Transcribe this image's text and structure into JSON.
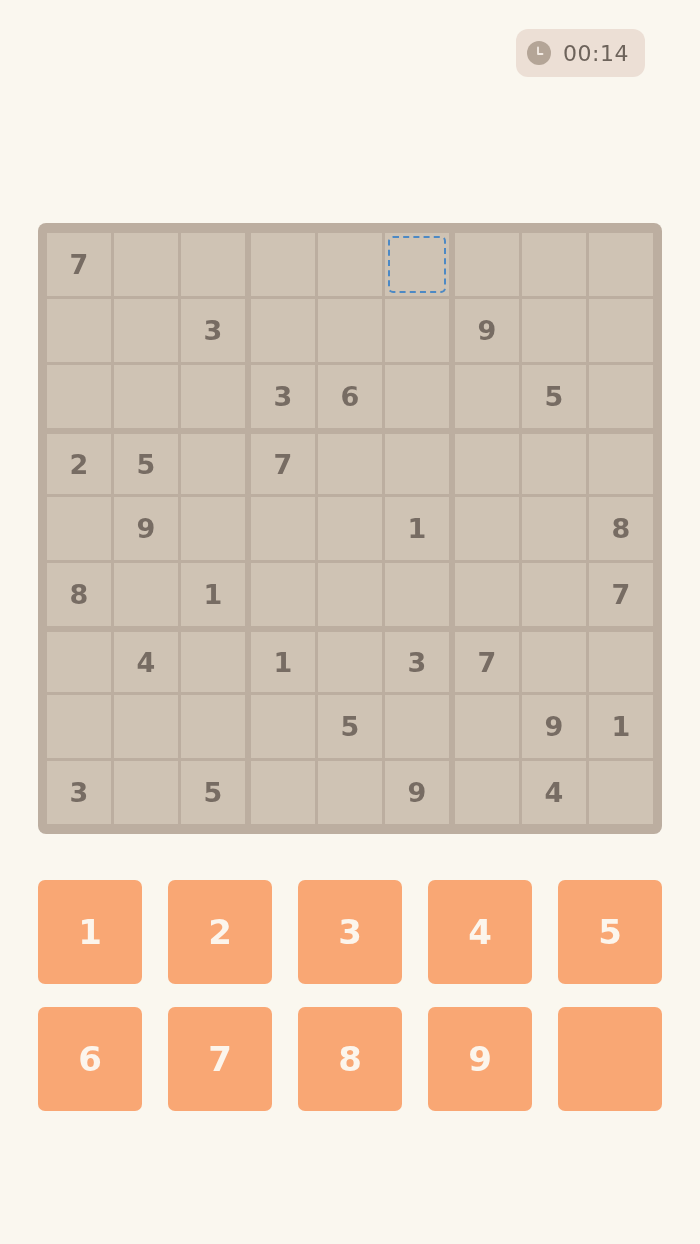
{
  "timer": {
    "text": "00:14"
  },
  "board": {
    "rows": [
      {
        "cells": [
          {
            "value": "7",
            "selected": false
          },
          {
            "selected": false
          },
          {
            "selected": false
          },
          {
            "selected": false
          },
          {
            "selected": false
          },
          {
            "selected": true
          },
          {
            "selected": false
          },
          {
            "selected": false
          },
          {
            "selected": false
          }
        ]
      },
      {
        "cells": [
          {
            "selected": false
          },
          {
            "selected": false
          },
          {
            "value": "3",
            "selected": false
          },
          {
            "selected": false
          },
          {
            "selected": false
          },
          {
            "selected": false
          },
          {
            "value": "9",
            "selected": false
          },
          {
            "selected": false
          },
          {
            "selected": false
          }
        ]
      },
      {
        "cells": [
          {
            "selected": false
          },
          {
            "selected": false
          },
          {
            "selected": false
          },
          {
            "value": "3",
            "selected": false
          },
          {
            "value": "6",
            "selected": false
          },
          {
            "selected": false
          },
          {
            "selected": false
          },
          {
            "value": "5",
            "selected": false
          },
          {
            "selected": false
          }
        ]
      },
      {
        "cells": [
          {
            "value": "2",
            "selected": false
          },
          {
            "value": "5",
            "selected": false
          },
          {
            "selected": false
          },
          {
            "value": "7",
            "selected": false
          },
          {
            "selected": false
          },
          {
            "selected": false
          },
          {
            "selected": false
          },
          {
            "selected": false
          },
          {
            "selected": false
          }
        ]
      },
      {
        "cells": [
          {
            "selected": false
          },
          {
            "value": "9",
            "selected": false
          },
          {
            "selected": false
          },
          {
            "selected": false
          },
          {
            "selected": false
          },
          {
            "value": "1",
            "selected": false
          },
          {
            "selected": false
          },
          {
            "selected": false
          },
          {
            "value": "8",
            "selected": false
          }
        ]
      },
      {
        "cells": [
          {
            "value": "8",
            "selected": false
          },
          {
            "selected": false
          },
          {
            "value": "1",
            "selected": false
          },
          {
            "selected": false
          },
          {
            "selected": false
          },
          {
            "selected": false
          },
          {
            "selected": false
          },
          {
            "selected": false
          },
          {
            "value": "7",
            "selected": false
          }
        ]
      },
      {
        "cells": [
          {
            "selected": false
          },
          {
            "value": "4",
            "selected": false
          },
          {
            "selected": false
          },
          {
            "value": "1",
            "selected": false
          },
          {
            "selected": false
          },
          {
            "value": "3",
            "selected": false
          },
          {
            "value": "7",
            "selected": false
          },
          {
            "selected": false
          },
          {
            "selected": false
          }
        ]
      },
      {
        "cells": [
          {
            "selected": false
          },
          {
            "selected": false
          },
          {
            "selected": false
          },
          {
            "selected": false
          },
          {
            "value": "5",
            "selected": false
          },
          {
            "selected": false
          },
          {
            "selected": false
          },
          {
            "value": "9",
            "selected": false
          },
          {
            "value": "1",
            "selected": false
          }
        ]
      },
      {
        "cells": [
          {
            "value": "3",
            "selected": false
          },
          {
            "selected": false
          },
          {
            "value": "5",
            "selected": false
          },
          {
            "selected": false
          },
          {
            "selected": false
          },
          {
            "value": "9",
            "selected": false
          },
          {
            "selected": false
          },
          {
            "value": "4",
            "selected": false
          },
          {
            "selected": false
          }
        ]
      }
    ]
  },
  "keypad": {
    "keys": [
      {
        "kind": "digit",
        "label": "1"
      },
      {
        "kind": "digit",
        "label": "2"
      },
      {
        "kind": "digit",
        "label": "3"
      },
      {
        "kind": "digit",
        "label": "4"
      },
      {
        "kind": "digit",
        "label": "5"
      },
      {
        "kind": "digit",
        "label": "6"
      },
      {
        "kind": "digit",
        "label": "7"
      },
      {
        "kind": "digit",
        "label": "8"
      },
      {
        "kind": "digit",
        "label": "9"
      },
      {
        "kind": "blank"
      }
    ]
  }
}
